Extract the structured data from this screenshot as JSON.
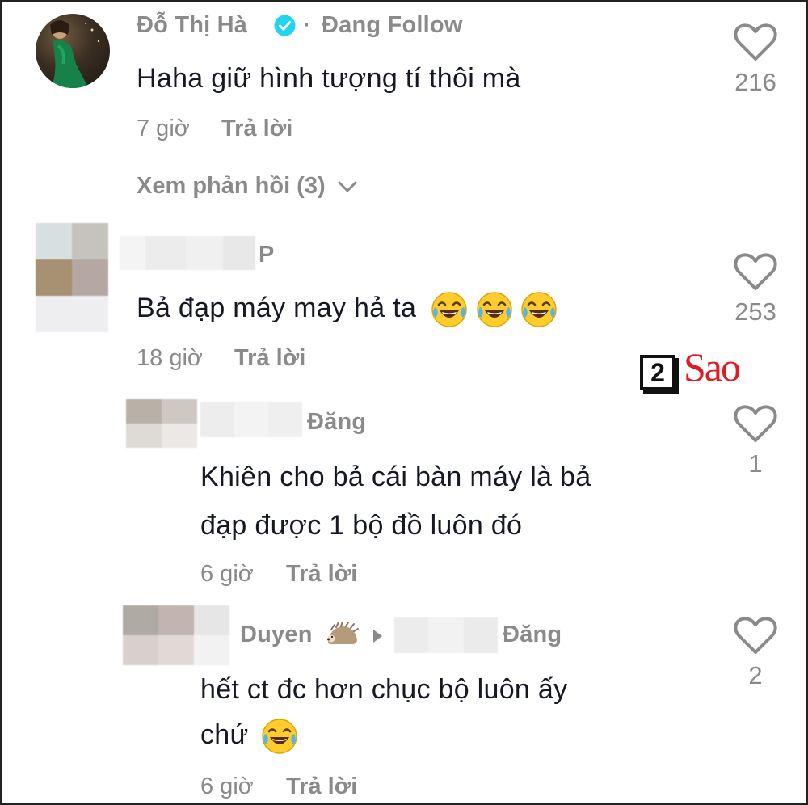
{
  "comments": [
    {
      "author": "Đỗ Thị Hà",
      "follow_status": "Đang Follow",
      "text": "Haha giữ hình tượng tí thôi mà",
      "time": "7 giờ",
      "reply_label": "Trả lời",
      "likes": "216",
      "view_replies": "Xem phản hồi (3)"
    },
    {
      "author": "P",
      "text": "Bả đạp máy may hả ta",
      "time": "18 giờ",
      "reply_label": "Trả lời",
      "likes": "253"
    }
  ],
  "replies": [
    {
      "author": "Đăng",
      "text_line1": "Khiên cho bả cái bàn máy là bả",
      "text_line2": "đạp được 1 bộ đồ luôn đó",
      "time": "6 giờ",
      "reply_label": "Trả lời",
      "likes": "1"
    },
    {
      "author": "Duyen",
      "reply_to": "Đăng",
      "text_line1": "hết ct đc hơn chục bộ luôn ấy",
      "text_line2": "chứ",
      "time": "6 giờ",
      "reply_label": "Trả lời",
      "likes": "2"
    }
  ],
  "watermark": {
    "digit": "2",
    "word": "Sao"
  },
  "colors": {
    "text": "#161823",
    "muted": "#8a8a8a",
    "verified": "#20d5ec",
    "watermark": "#e21b23"
  }
}
